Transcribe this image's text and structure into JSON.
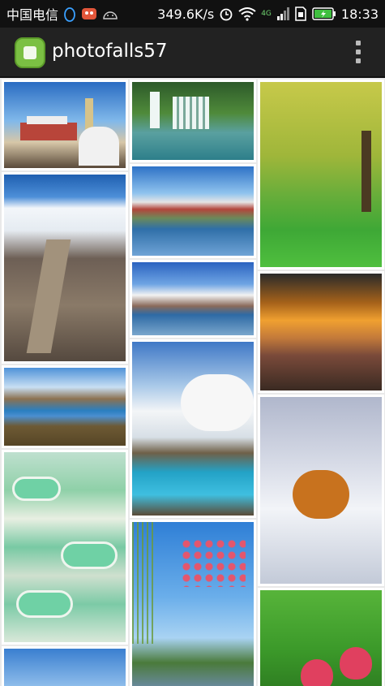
{
  "statusbar": {
    "carrier": "中国电信",
    "net_speed": "349.6K/s",
    "net_type": "4G",
    "time": "18:33",
    "icons": [
      "qq-penguin-icon",
      "tiger-face-icon",
      "android-robot-icon",
      "alarm-icon",
      "wifi-icon",
      "signal-icon",
      "sim-icon",
      "battery-charging-icon"
    ]
  },
  "actionbar": {
    "title": "photofalls57",
    "app_icon": "app-cube-icon",
    "menu_icon": "overflow-menu-icon"
  },
  "photos": [
    {
      "name": "potala-palace-stupa"
    },
    {
      "name": "waterfall-lake"
    },
    {
      "name": "autumn-tree-lawn"
    },
    {
      "name": "palace-reflection-lake"
    },
    {
      "name": "mountain-valley-clouds"
    },
    {
      "name": "mountain-lake-panorama"
    },
    {
      "name": "palace-sunset"
    },
    {
      "name": "lake-valley-road"
    },
    {
      "name": "clouds-turquoise-lake"
    },
    {
      "name": "tiger-snow"
    },
    {
      "name": "terraced-pools"
    },
    {
      "name": "willow-blossom-pagoda"
    },
    {
      "name": "heart-flowers"
    },
    {
      "name": "blue-sky-partial"
    }
  ]
}
